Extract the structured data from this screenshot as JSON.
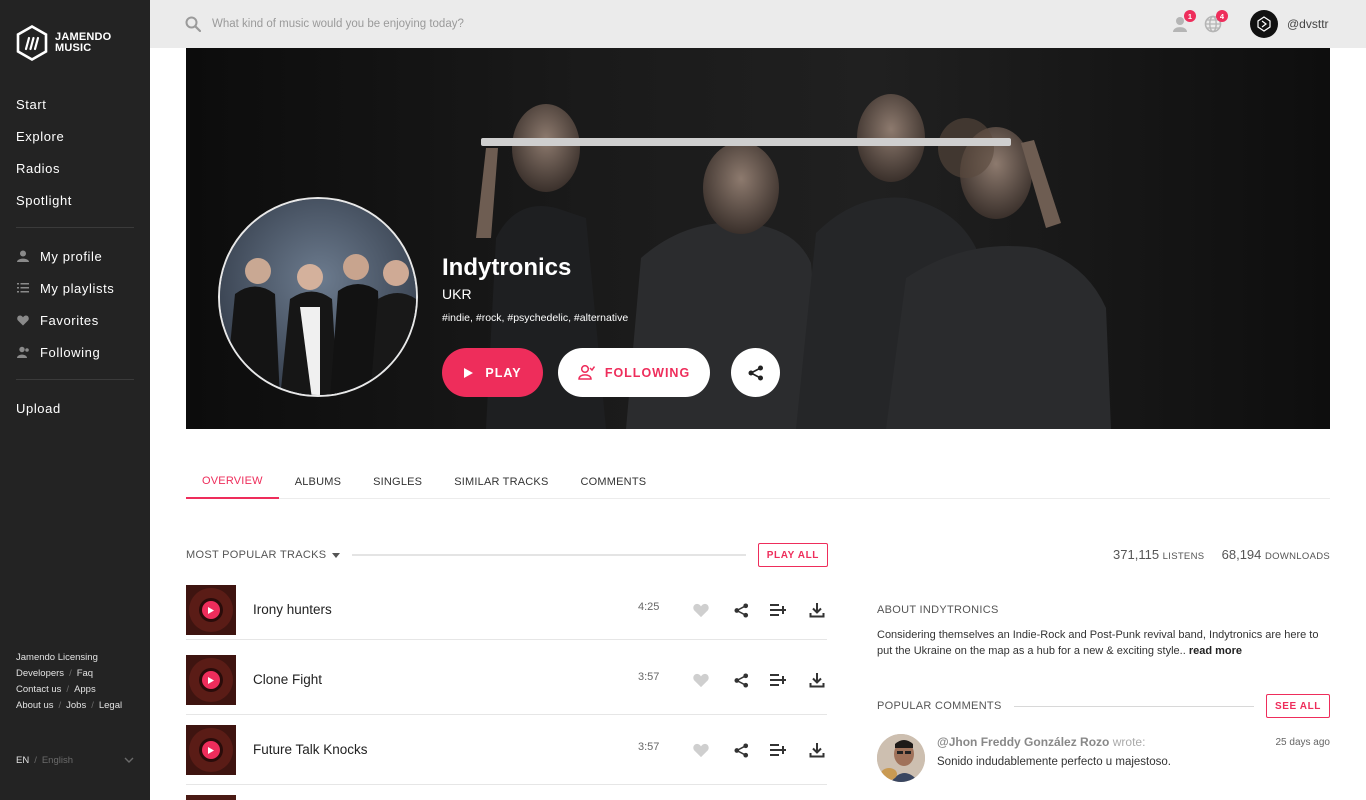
{
  "brand": {
    "line1": "JAMENDO",
    "line2": "MUSIC"
  },
  "sidebar": {
    "main_nav": [
      {
        "label": "Start"
      },
      {
        "label": "Explore"
      },
      {
        "label": "Radios"
      },
      {
        "label": "Spotlight"
      }
    ],
    "user_nav": [
      {
        "label": "My profile",
        "icon": "user-icon"
      },
      {
        "label": "My playlists",
        "icon": "list-icon"
      },
      {
        "label": "Favorites",
        "icon": "heart-icon"
      },
      {
        "label": "Following",
        "icon": "followers-icon"
      }
    ],
    "upload": "Upload",
    "footer": {
      "licensing": "Jamendo Licensing",
      "developers": "Developers",
      "faq": "Faq",
      "contact": "Contact us",
      "apps": "Apps",
      "about": "About us",
      "jobs": "Jobs",
      "legal": "Legal",
      "sep": "/"
    },
    "language": {
      "code": "EN",
      "sep": "/",
      "name": "English"
    }
  },
  "topbar": {
    "search_placeholder": "What kind of music would you be enjoying today?",
    "notif_badge": "1",
    "world_badge": "4",
    "username": "@dvsttr"
  },
  "artist": {
    "name": "Indytronics",
    "country": "UKR",
    "tags": "#indie, #rock, #psychedelic, #alternative",
    "play_label": "PLAY",
    "follow_label": "FOLLOWING"
  },
  "tabs": [
    {
      "label": "OVERVIEW",
      "active": true
    },
    {
      "label": "ALBUMS"
    },
    {
      "label": "SINGLES"
    },
    {
      "label": "SIMILAR TRACKS"
    },
    {
      "label": "COMMENTS"
    }
  ],
  "tracks": {
    "header": "MOST POPULAR TRACKS",
    "play_all": "PLAY ALL",
    "items": [
      {
        "name": "Irony hunters",
        "duration": "4:25"
      },
      {
        "name": "Clone Fight",
        "duration": "3:57"
      },
      {
        "name": "Future Talk Knocks",
        "duration": "3:57"
      }
    ]
  },
  "stats": {
    "listens": "371,115",
    "listens_label": "LISTENS",
    "downloads": "68,194",
    "downloads_label": "DOWNLOADS"
  },
  "about": {
    "title": "ABOUT INDYTRONICS",
    "text": "Considering themselves an Indie-Rock and Post-Punk revival band, Indytronics are here to put the Ukraine on the map as a hub for a new & exciting style..",
    "read_more": "read more"
  },
  "comments": {
    "header": "POPULAR COMMENTS",
    "see_all": "SEE ALL",
    "items": [
      {
        "author": "@Jhon Freddy González Rozo",
        "wrote": "wrote:",
        "time": "25 days ago",
        "text": "Sonido indudablemente perfecto u majestoso."
      }
    ]
  },
  "colors": {
    "accent": "#ee2d5b",
    "sidebar": "#232323",
    "topbar": "#ebebeb"
  }
}
